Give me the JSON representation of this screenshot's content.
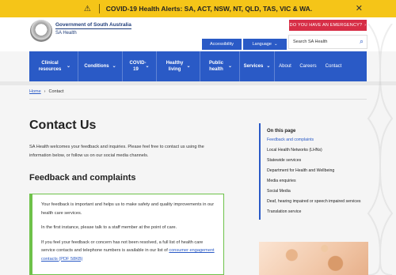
{
  "alert": {
    "icon": "warning-icon",
    "text": "COVID-19 Health Alerts: SA, ACT, NSW, NT, QLD, TAS, VIC & WA.",
    "close": "✕"
  },
  "header": {
    "govt": "Government of South Australia",
    "agency": "SA Health",
    "emergency": "DO YOU HAVE AN EMERGENCY?",
    "accessibility": "Accessibility",
    "language": "Language",
    "search_placeholder": "Search SA Health"
  },
  "nav": {
    "items": [
      {
        "label": "Clinical resources"
      },
      {
        "label": "Conditions"
      },
      {
        "label": "COVID-19"
      },
      {
        "label": "Healthy living"
      },
      {
        "label": "Public health"
      },
      {
        "label": "Services"
      }
    ],
    "plain": [
      "About",
      "Careers",
      "Contact"
    ]
  },
  "breadcrumb": {
    "home": "Home",
    "current": "Contact"
  },
  "page": {
    "title": "Contact Us",
    "intro": "SA Health welcomes your feedback and inquiries. Please feel free to contact us using the information below, or follow us on our social media channels.",
    "section_title": "Feedback and complaints",
    "callout": {
      "p1": "Your feedback is important and helps us to make safety and quality improvements in our health care services.",
      "p2": "In the first instance, please talk to a staff member at the point of care.",
      "p3": "If you feel your feedback or concern has not been resolved, a full list of health care service contacts and telephone numbers is available in our list of",
      "link": "consumer engagement contacts (PDF 58KB)"
    }
  },
  "on_this_page": {
    "title": "On this page",
    "links": [
      "Feedback and complaints",
      "Local Health Networks (LHNs)",
      "Statewide services",
      "Department for Health and Wellbeing",
      "Media enquiries",
      "Social Media",
      "Deaf, hearing impaired or speech impaired services",
      "Translation service"
    ]
  },
  "colors": {
    "brand_blue": "#2a5ac6",
    "alert_yellow": "#f5c518",
    "emergency_red": "#d72e46",
    "callout_green": "#6ec24a"
  }
}
